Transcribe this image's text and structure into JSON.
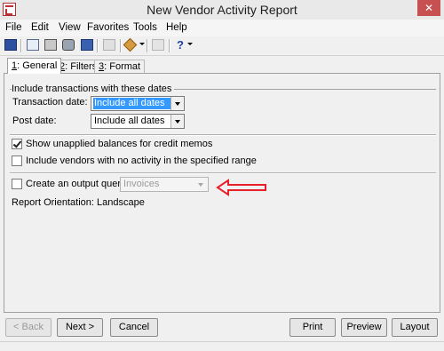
{
  "window": {
    "title": "New Vendor Activity Report",
    "close_glyph": "✕"
  },
  "menu": {
    "items": [
      "File",
      "Edit",
      "View",
      "Favorites",
      "Tools",
      "Help"
    ]
  },
  "toolbar": {
    "help_glyph": "?"
  },
  "tabs": [
    {
      "key": "1",
      "label": ": General"
    },
    {
      "key": "2",
      "label": ": Filters"
    },
    {
      "key": "3",
      "label": ": Format"
    }
  ],
  "general": {
    "group_label": "Include transactions with these dates",
    "transaction_date_label": "Transaction date:",
    "transaction_date_value": "Include all dates",
    "post_date_label": "Post date:",
    "post_date_value": "Include all dates",
    "show_unapplied_label": "Show unapplied balances for credit memos",
    "show_unapplied_checked": true,
    "include_vendors_label": "Include vendors with no activity in the specified range",
    "include_vendors_checked": false,
    "output_query_label": "Create an output query of",
    "output_query_checked": false,
    "output_query_value": "Invoices",
    "report_orientation": "Report Orientation: Landscape",
    "annotation_arrow_color": "#e8202a"
  },
  "buttons": {
    "back": "< Back",
    "next": "Next >",
    "cancel": "Cancel",
    "print": "Print",
    "preview": "Preview",
    "layout": "Layout"
  },
  "icons": {
    "app": "report-app-icon",
    "save": "save-icon",
    "print_preview": "print-preview-icon",
    "print": "printer-icon",
    "fax": "fax-icon",
    "email": "email-icon",
    "disabled_tool": "disabled-tool-icon",
    "tag": "tag-icon",
    "favorites": "favorites-folder-icon",
    "help": "help-icon"
  }
}
